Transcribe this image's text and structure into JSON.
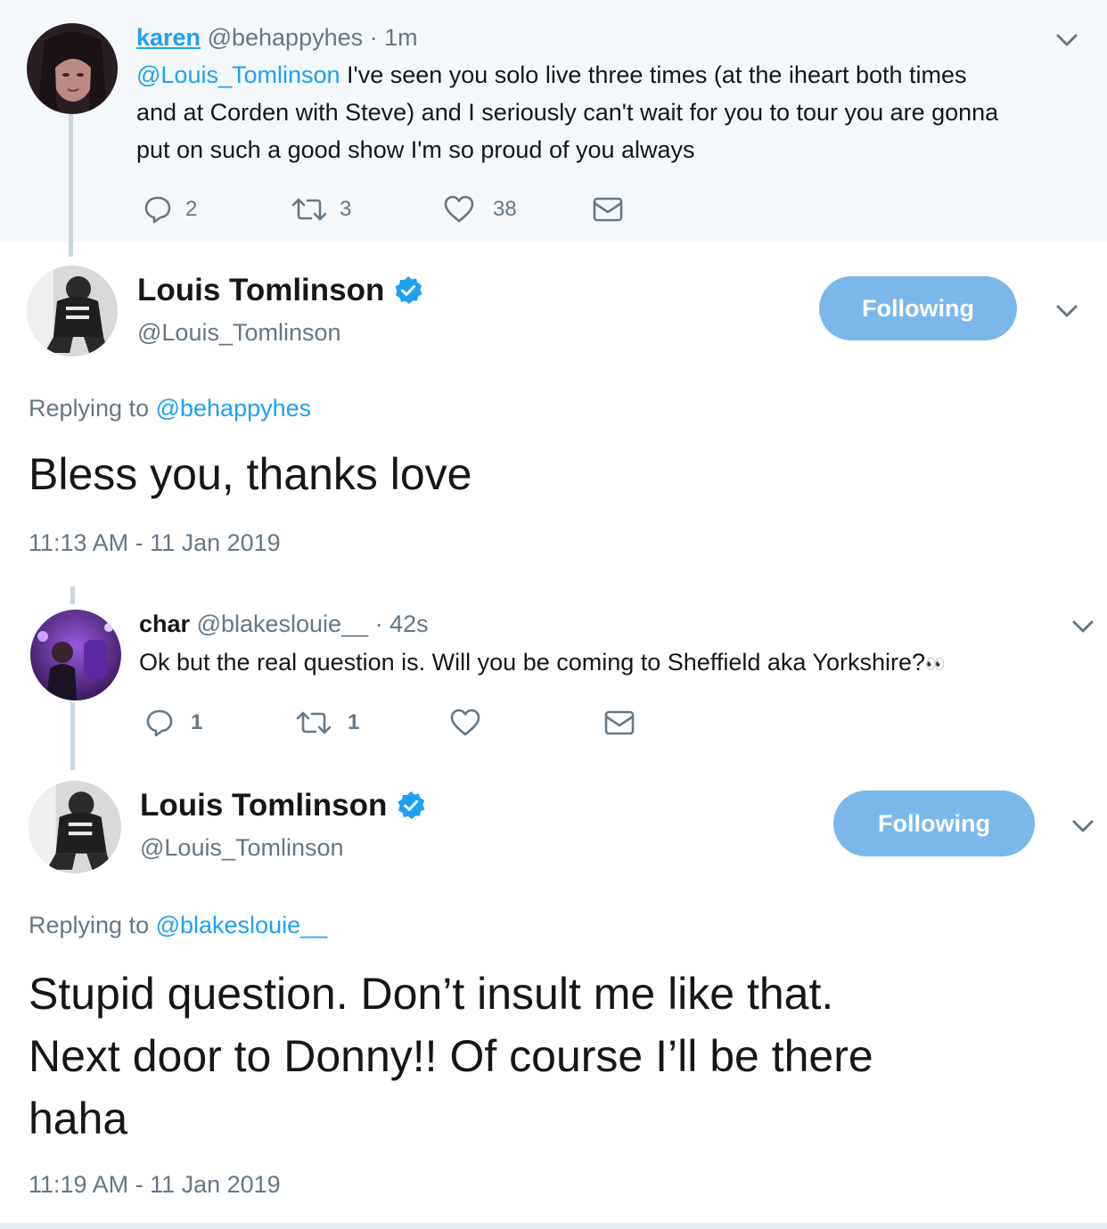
{
  "reply1": {
    "name": "karen",
    "handle": "@behappyhes",
    "time": "· 1m",
    "mention": "@Louis_Tomlinson",
    "text_line1": " I've seen you solo live three times (at the iheart both times",
    "text_line2": "and at Corden with Steve) and I seriously can't wait for you to tour you are gonna",
    "text_line3": "put on such a good show I'm so proud of you always",
    "replies": "2",
    "retweets": "3",
    "likes": "38"
  },
  "tweet1": {
    "name": "Louis Tomlinson",
    "handle": "@Louis_Tomlinson",
    "follow_label": "Following",
    "replying_prefix": "Replying to ",
    "replying_to": "@behappyhes",
    "text": "Bless you, thanks love",
    "timestamp": "11:13 AM - 11 Jan 2019"
  },
  "reply2": {
    "name": "char",
    "handle": "@blakeslouie__",
    "time": "· 42s",
    "text": "Ok but the real question is. Will you be coming to Sheffield aka Yorkshire?",
    "emoji": "👀",
    "replies": "1",
    "retweets": "1"
  },
  "tweet2": {
    "name": "Louis Tomlinson",
    "handle": "@Louis_Tomlinson",
    "follow_label": "Following",
    "replying_prefix": "Replying to ",
    "replying_to": "@blakeslouie__",
    "text_line1": "Stupid question. Don’t insult me like that.",
    "text_line2": "Next door to Donny!! Of course I’ll be there",
    "text_line3": "haha",
    "timestamp": "11:19 AM - 11 Jan 2019"
  },
  "colors": {
    "link": "#1da1f2",
    "muted": "#657786",
    "follow_button": "#7ab8ec",
    "verified": "#1da1f2",
    "reply_background": "#f5f8fa"
  },
  "icons": [
    "reply-icon",
    "retweet-icon",
    "like-icon",
    "dm-icon",
    "chevron-down-icon",
    "verified-badge-icon"
  ]
}
